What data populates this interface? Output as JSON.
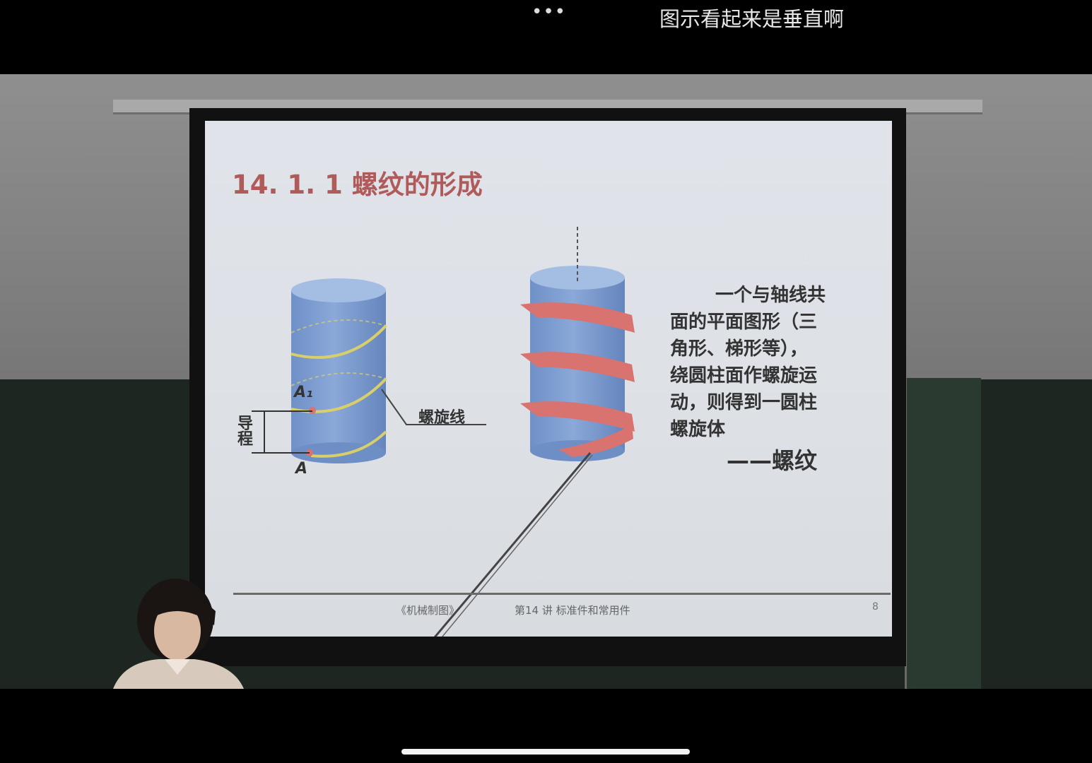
{
  "topbar": {
    "more_label": "•••",
    "caption": "图示看起来是垂直啊"
  },
  "slide": {
    "title": "14. 1. 1  螺纹的形成",
    "helix_label": "螺旋线",
    "lead_label": "导程",
    "point_a": "A",
    "point_a1": "A₁",
    "paragraph_lines": [
      "一个与轴线共",
      "面的平面图形（三",
      "角形、梯形等），",
      "绕圆柱面作螺旋运",
      "动，则得到一圆柱",
      "螺旋体"
    ],
    "thread_label": "——螺纹",
    "footer_book": "《机械制图》",
    "footer_lecture": "第14 讲  标准件和常用件",
    "page_number": "8"
  },
  "colors": {
    "title": "#b05a5a",
    "cylinder": "#7c9dd0",
    "helix": "#d8cf6a",
    "thread": "#d97370",
    "screen": "#e0e4ea"
  }
}
